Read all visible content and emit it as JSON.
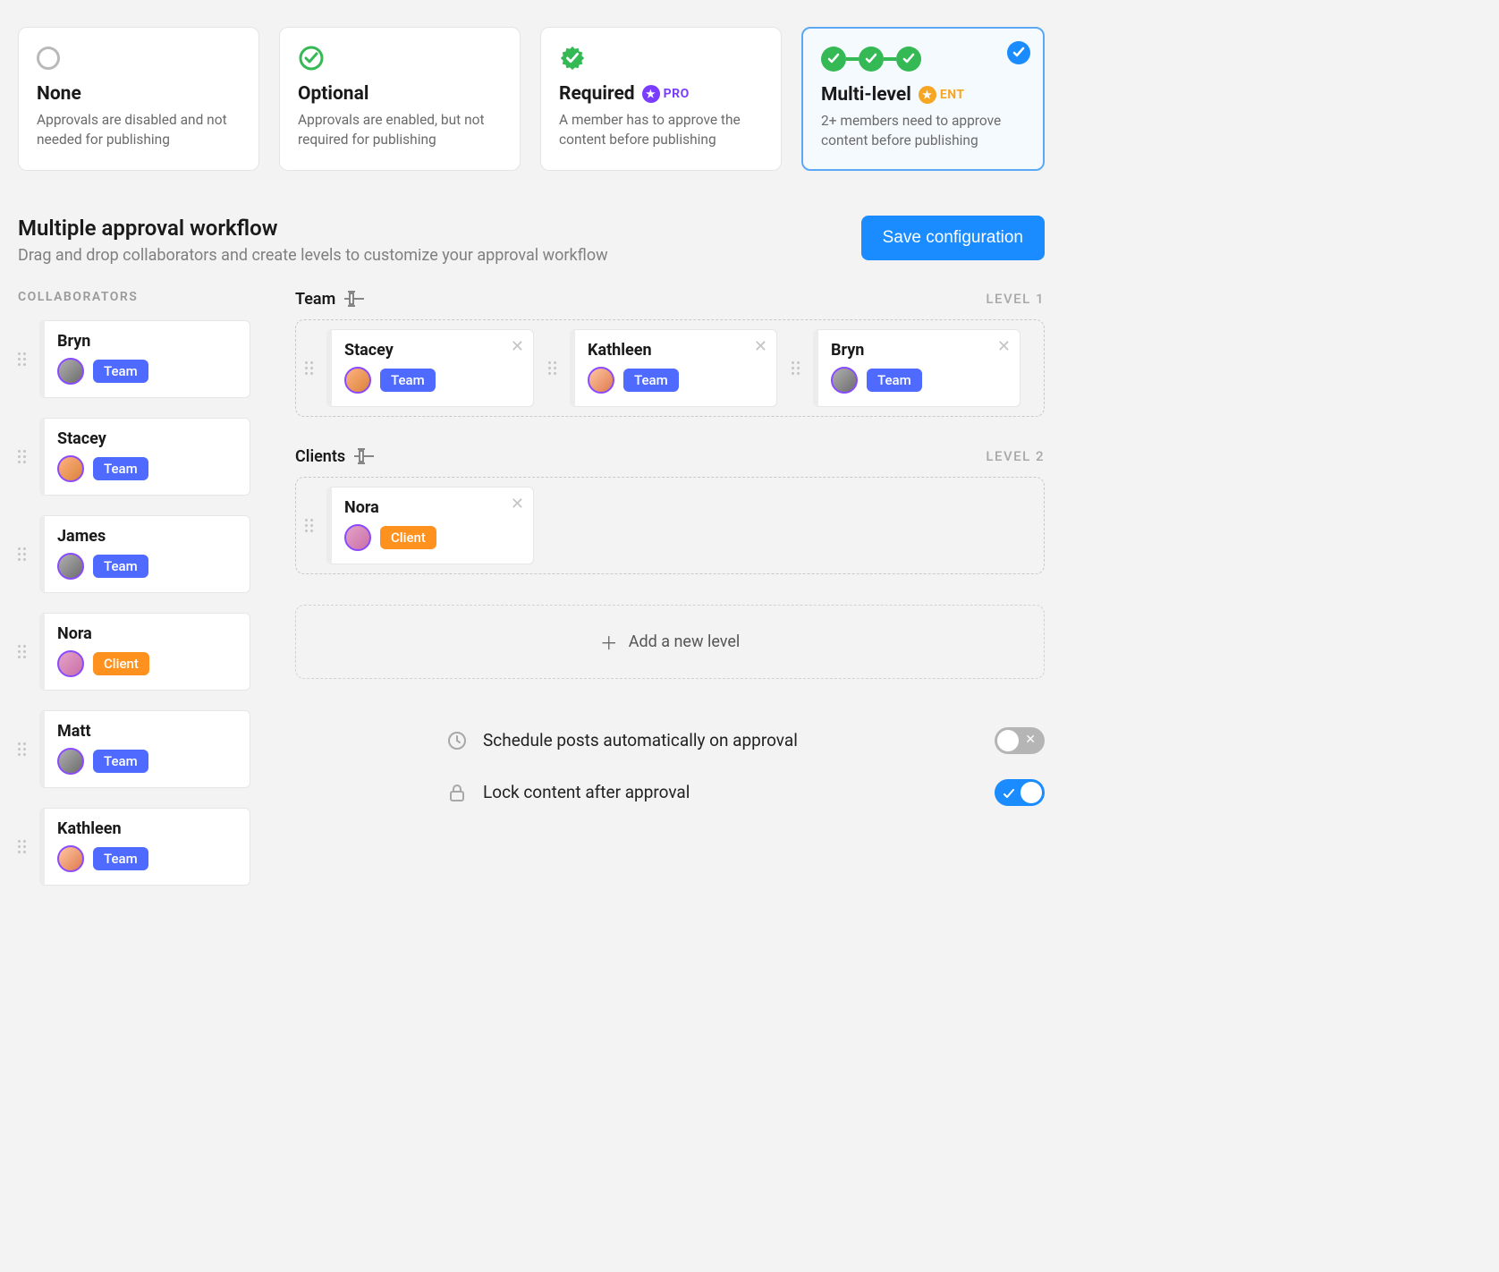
{
  "options": [
    {
      "title": "None",
      "desc": "Approvals are disabled and not needed for publishing",
      "badge": ""
    },
    {
      "title": "Optional",
      "desc": "Approvals are enabled, but not required for publishing",
      "badge": ""
    },
    {
      "title": "Required",
      "desc": "A member has to approve the content before publishing",
      "badge": "PRO"
    },
    {
      "title": "Multi-level",
      "desc": "2+ members need to approve content before publishing",
      "badge": "ENT"
    }
  ],
  "selected_option_index": 3,
  "section": {
    "title": "Multiple approval workflow",
    "subtitle": "Drag and drop collaborators and create levels to customize your approval workflow",
    "save_label": "Save configuration"
  },
  "collab_heading": "COLLABORATORS",
  "collaborators": [
    {
      "name": "Bryn",
      "role": "Team",
      "role_class": "team",
      "avatar": "f2"
    },
    {
      "name": "Stacey",
      "role": "Team",
      "role_class": "team",
      "avatar": "f1"
    },
    {
      "name": "James",
      "role": "Team",
      "role_class": "team",
      "avatar": "f2"
    },
    {
      "name": "Nora",
      "role": "Client",
      "role_class": "client",
      "avatar": "f4"
    },
    {
      "name": "Matt",
      "role": "Team",
      "role_class": "team",
      "avatar": "f2"
    },
    {
      "name": "Kathleen",
      "role": "Team",
      "role_class": "team",
      "avatar": "f3"
    }
  ],
  "levels": [
    {
      "name": "Team",
      "level_label": "LEVEL 1",
      "members": [
        {
          "name": "Stacey",
          "role": "Team",
          "role_class": "team",
          "avatar": "f1"
        },
        {
          "name": "Kathleen",
          "role": "Team",
          "role_class": "team",
          "avatar": "f3"
        },
        {
          "name": "Bryn",
          "role": "Team",
          "role_class": "team",
          "avatar": "f2"
        }
      ]
    },
    {
      "name": "Clients",
      "level_label": "LEVEL 2",
      "members": [
        {
          "name": "Nora",
          "role": "Client",
          "role_class": "client",
          "avatar": "f4"
        }
      ]
    }
  ],
  "add_level_label": "Add a new level",
  "settings": {
    "schedule": {
      "label": "Schedule posts automatically on approval",
      "on": false
    },
    "lock": {
      "label": "Lock content after approval",
      "on": true
    }
  }
}
